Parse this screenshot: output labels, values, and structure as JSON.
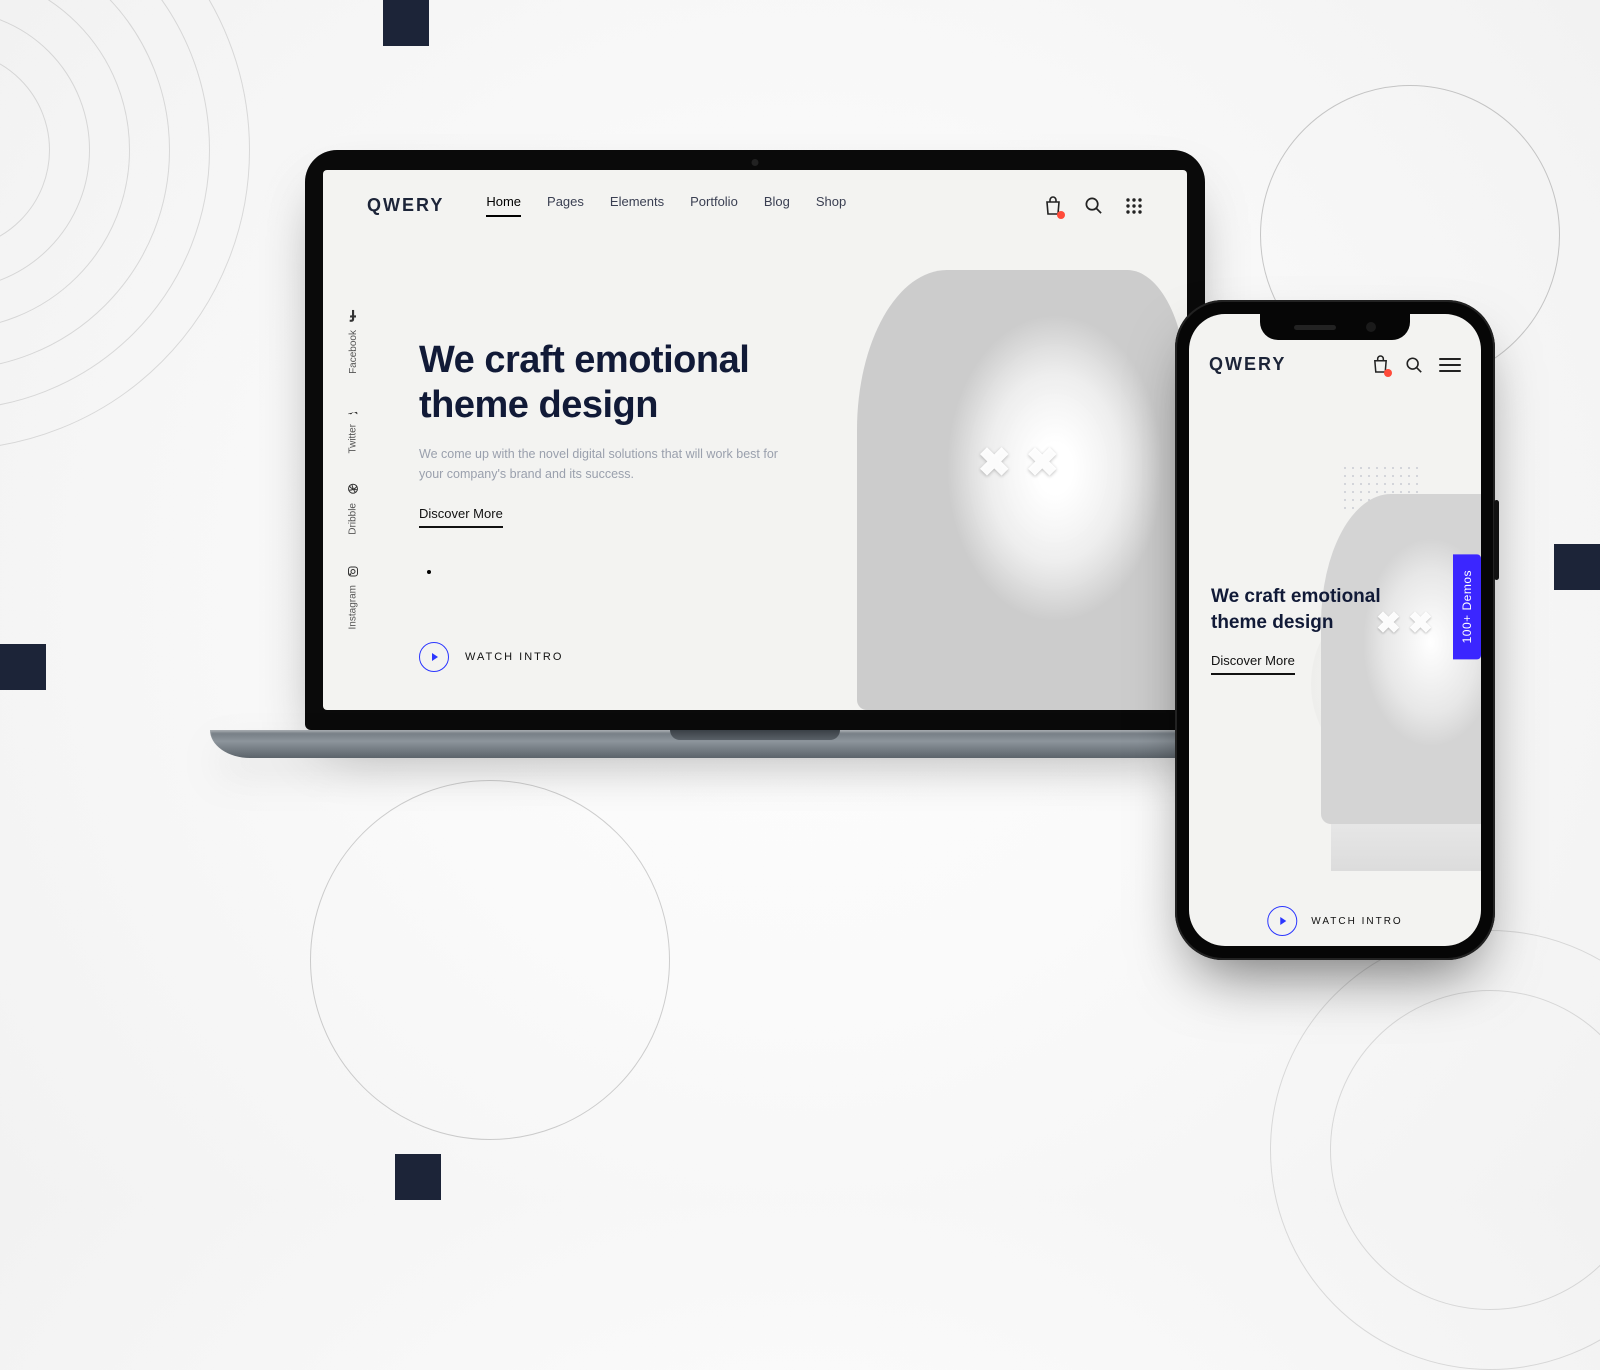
{
  "brand": "QWERY",
  "nav": {
    "items": [
      "Home",
      "Pages",
      "Elements",
      "Portfolio",
      "Blog",
      "Shop"
    ],
    "active": "Home"
  },
  "hero": {
    "title_line1": "We craft emotional",
    "title_line2": "theme design",
    "subtitle": "We come up with the novel digital solutions that will work best for your company's brand and its success.",
    "cta": "Discover More",
    "watch_label": "WATCH INTRO"
  },
  "social": [
    "Facebook",
    "Twitter",
    "Dribble",
    "Instagram"
  ],
  "mobile": {
    "title_line1": "We craft emotional",
    "title_line2": "theme design",
    "cta": "Discover More",
    "watch_label": "WATCH INTRO",
    "demos_tab": "100+ Demos"
  },
  "icons": {
    "cart": "shopping-bag-icon",
    "search": "search-icon",
    "apps": "apps-grid-icon",
    "menu": "hamburger-menu-icon"
  },
  "colors": {
    "accent_orange": "#ff5a3c",
    "accent_blue": "#2b36ff",
    "accent_purple": "#3b26ff",
    "dark": "#1c2438"
  }
}
